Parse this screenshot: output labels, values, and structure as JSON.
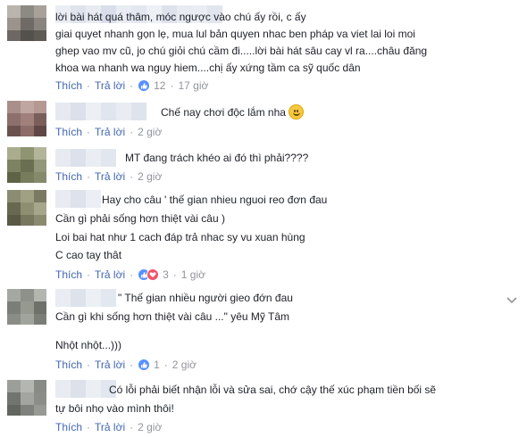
{
  "actions": {
    "like": "Thích",
    "reply": "Trả lời",
    "dot": "·"
  },
  "comments": [
    {
      "text": "lời bài hát quá thâm, móc ngược vào chú ấy rồi, c ấy\ngiai quyet nhanh gọn lẹ, mua lul bản quyen nhac ben pháp va viet lai loi moi\nghep vao mv cũ, jo chú giỏi chú cầm đi.....lời bài hát sâu cay vl ra....châu đăng\nkhoa wa nhanh wa nguy hiem....chị ấy xứng tầm ca sỹ quốc dân",
      "reactions": "12",
      "reaction_icons": [
        "like-icon"
      ],
      "time": "17 giờ"
    },
    {
      "text": "Chế nay chơi độc lắm nha",
      "emoji": "smile-emoji",
      "time": "2 giờ"
    },
    {
      "text": "MT đang trách khéo ai đó thì phải????",
      "time": "2 giờ"
    },
    {
      "lines": [
        "Hay cho câu ' thế gian nhieu nguoi reo đơn đau",
        "Cần gì phải sống hơn thiệt vài câu )",
        "Loi bai hat như 1 cach đáp trả nhac sy vu xuan hùng",
        "C cao tay thât"
      ],
      "reactions": "3",
      "reaction_icons": [
        "like-icon",
        "love-icon"
      ],
      "time": "1 giờ"
    },
    {
      "lines": [
        "\" Thế gian nhiều người gieo đớn đau",
        "Cần gì khi sống hơn thiệt vài câu ...\" yêu Mỹ Tâm",
        "",
        "Nhột nhột...)))"
      ],
      "reactions": "1",
      "reaction_icons": [
        "like-icon"
      ],
      "time": "2 giờ"
    },
    {
      "lines": [
        "Có lỗi phải biết nhận lỗi và sửa sai, chớ cậy thế xúc phạm tiền bối sẽ",
        "tự bôi nhọ vào mình thôi!"
      ],
      "time": "2 giờ"
    }
  ],
  "colors": {
    "link": "#4267b2",
    "meta": "#90949c",
    "like": "#5890ff",
    "love": "#f25268"
  }
}
